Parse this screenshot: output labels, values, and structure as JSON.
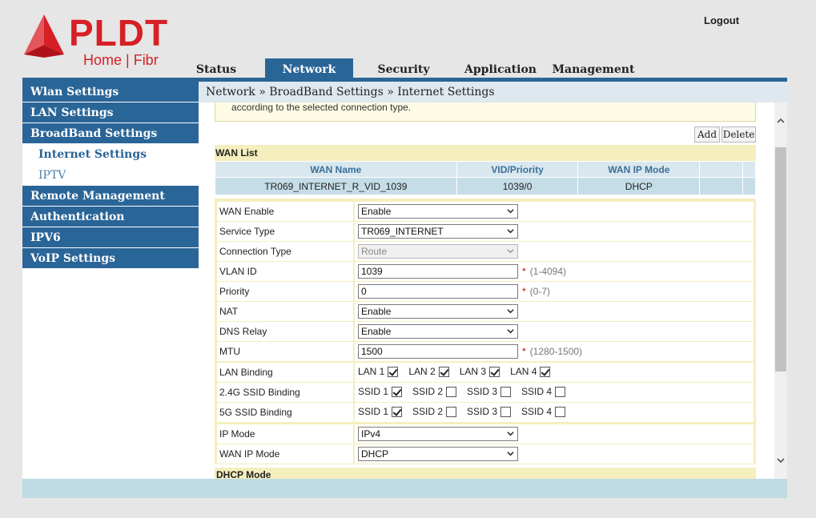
{
  "header": {
    "brand": "PLDT",
    "sub_brand": "Home | Fibr",
    "logout": "Logout"
  },
  "tabs": [
    {
      "label": "Status"
    },
    {
      "label": "Network"
    },
    {
      "label": "Security"
    },
    {
      "label": "Application"
    },
    {
      "label": "Management"
    }
  ],
  "sidebar": {
    "items": [
      {
        "label": "Wlan Settings"
      },
      {
        "label": "LAN Settings"
      },
      {
        "label": "BroadBand Settings"
      },
      {
        "label": "Internet Settings"
      },
      {
        "label": "IPTV"
      },
      {
        "label": "Remote Management"
      },
      {
        "label": "Authentication"
      },
      {
        "label": "IPV6"
      },
      {
        "label": "VoIP Settings"
      }
    ]
  },
  "breadcrumb": "Network » BroadBand Settings » Internet Settings",
  "notice": "according to the selected connection type.",
  "buttons": {
    "add": "Add",
    "delete": "Delete"
  },
  "wan_list": {
    "title": "WAN List",
    "headers": [
      "WAN Name",
      "VID/Priority",
      "WAN IP Mode"
    ],
    "rows": [
      {
        "name": "TR069_INTERNET_R_VID_1039",
        "vid_priority": "1039/0",
        "ip_mode": "DHCP"
      }
    ]
  },
  "form": {
    "wan_enable": {
      "label": "WAN Enable",
      "value": "Enable"
    },
    "service_type": {
      "label": "Service Type",
      "value": "TR069_INTERNET"
    },
    "connection_type": {
      "label": "Connection Type",
      "value": "Route"
    },
    "vlan_id": {
      "label": "VLAN ID",
      "value": "1039",
      "hint": "(1-4094)"
    },
    "priority": {
      "label": "Priority",
      "value": "0",
      "hint": "(0-7)"
    },
    "nat": {
      "label": "NAT",
      "value": "Enable"
    },
    "dns_relay": {
      "label": "DNS Relay",
      "value": "Enable"
    },
    "mtu": {
      "label": "MTU",
      "value": "1500",
      "hint": "(1280-1500)"
    },
    "lan_binding": {
      "label": "LAN Binding",
      "options": [
        {
          "label": "LAN 1",
          "checked": true
        },
        {
          "label": "LAN 2",
          "checked": true
        },
        {
          "label": "LAN 3",
          "checked": true
        },
        {
          "label": "LAN 4",
          "checked": true
        }
      ]
    },
    "ssid24_binding": {
      "label": "2.4G SSID Binding",
      "options": [
        {
          "label": "SSID 1",
          "checked": true
        },
        {
          "label": "SSID 2",
          "checked": false
        },
        {
          "label": "SSID 3",
          "checked": false
        },
        {
          "label": "SSID 4",
          "checked": false
        }
      ]
    },
    "ssid5_binding": {
      "label": "5G SSID Binding",
      "options": [
        {
          "label": "SSID 1",
          "checked": true
        },
        {
          "label": "SSID 2",
          "checked": false
        },
        {
          "label": "SSID 3",
          "checked": false
        },
        {
          "label": "SSID 4",
          "checked": false
        }
      ]
    },
    "ip_mode": {
      "label": "IP Mode",
      "value": "IPv4"
    },
    "wan_ip_mode": {
      "label": "WAN IP Mode",
      "value": "DHCP"
    },
    "required_mark": "*"
  },
  "dhcp_mode_title": "DHCP Mode",
  "colors": {
    "brand_red": "#d71f26",
    "nav_blue": "#2a6597",
    "panel_yellow": "#f5eebd",
    "table_blue": "#c5dde6"
  }
}
